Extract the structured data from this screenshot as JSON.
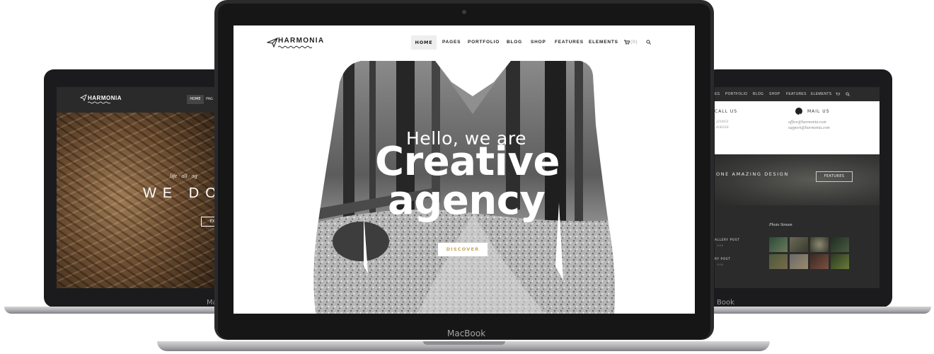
{
  "left_laptop": {
    "logo": "HARMONIA",
    "nav": {
      "home": "HOME",
      "pages_partial": "PAG"
    },
    "tagline": "life · all · ag",
    "headline": "WE DO",
    "button": "EX",
    "base_label": "Ma"
  },
  "center_laptop": {
    "logo": "HARMONIA",
    "nav": {
      "home": "HOME",
      "pages": "PAGES",
      "portfolio": "PORTFOLIO",
      "blog": "BLOG",
      "shop": "SHOP",
      "features": "FEATURES",
      "elements": "ELEMENTS",
      "cart_count": "(0)"
    },
    "hero": {
      "line1": "Hello, we are",
      "line2": "Creative",
      "line3": "agency",
      "button": "DISCOVER"
    },
    "base_label": "MacBook",
    "accent_color": "#c9a35a"
  },
  "right_laptop": {
    "nav": {
      "pages_partial": "ES",
      "portfolio": "PORTFOLIO",
      "blog": "BLOG",
      "shop": "SHOP",
      "features": "FEATURES",
      "elements": "ELEMENTS"
    },
    "contact": {
      "call_label": "CALL US",
      "phone1": "2214151",
      "phone2": "4141516",
      "mail_label": "MAIL US",
      "email1": "office@harmonia.com",
      "email2": "support@harmonia.com"
    },
    "banner": {
      "text": "ONE AMAZING DESIGN",
      "button": "FEATURES"
    },
    "footer": {
      "photo_stream": "Photo Stream",
      "post1": "ALLERY POST",
      "post1_date": "2016",
      "post2": "RY POST",
      "post2_date": "2016"
    },
    "base_label": "Book"
  }
}
